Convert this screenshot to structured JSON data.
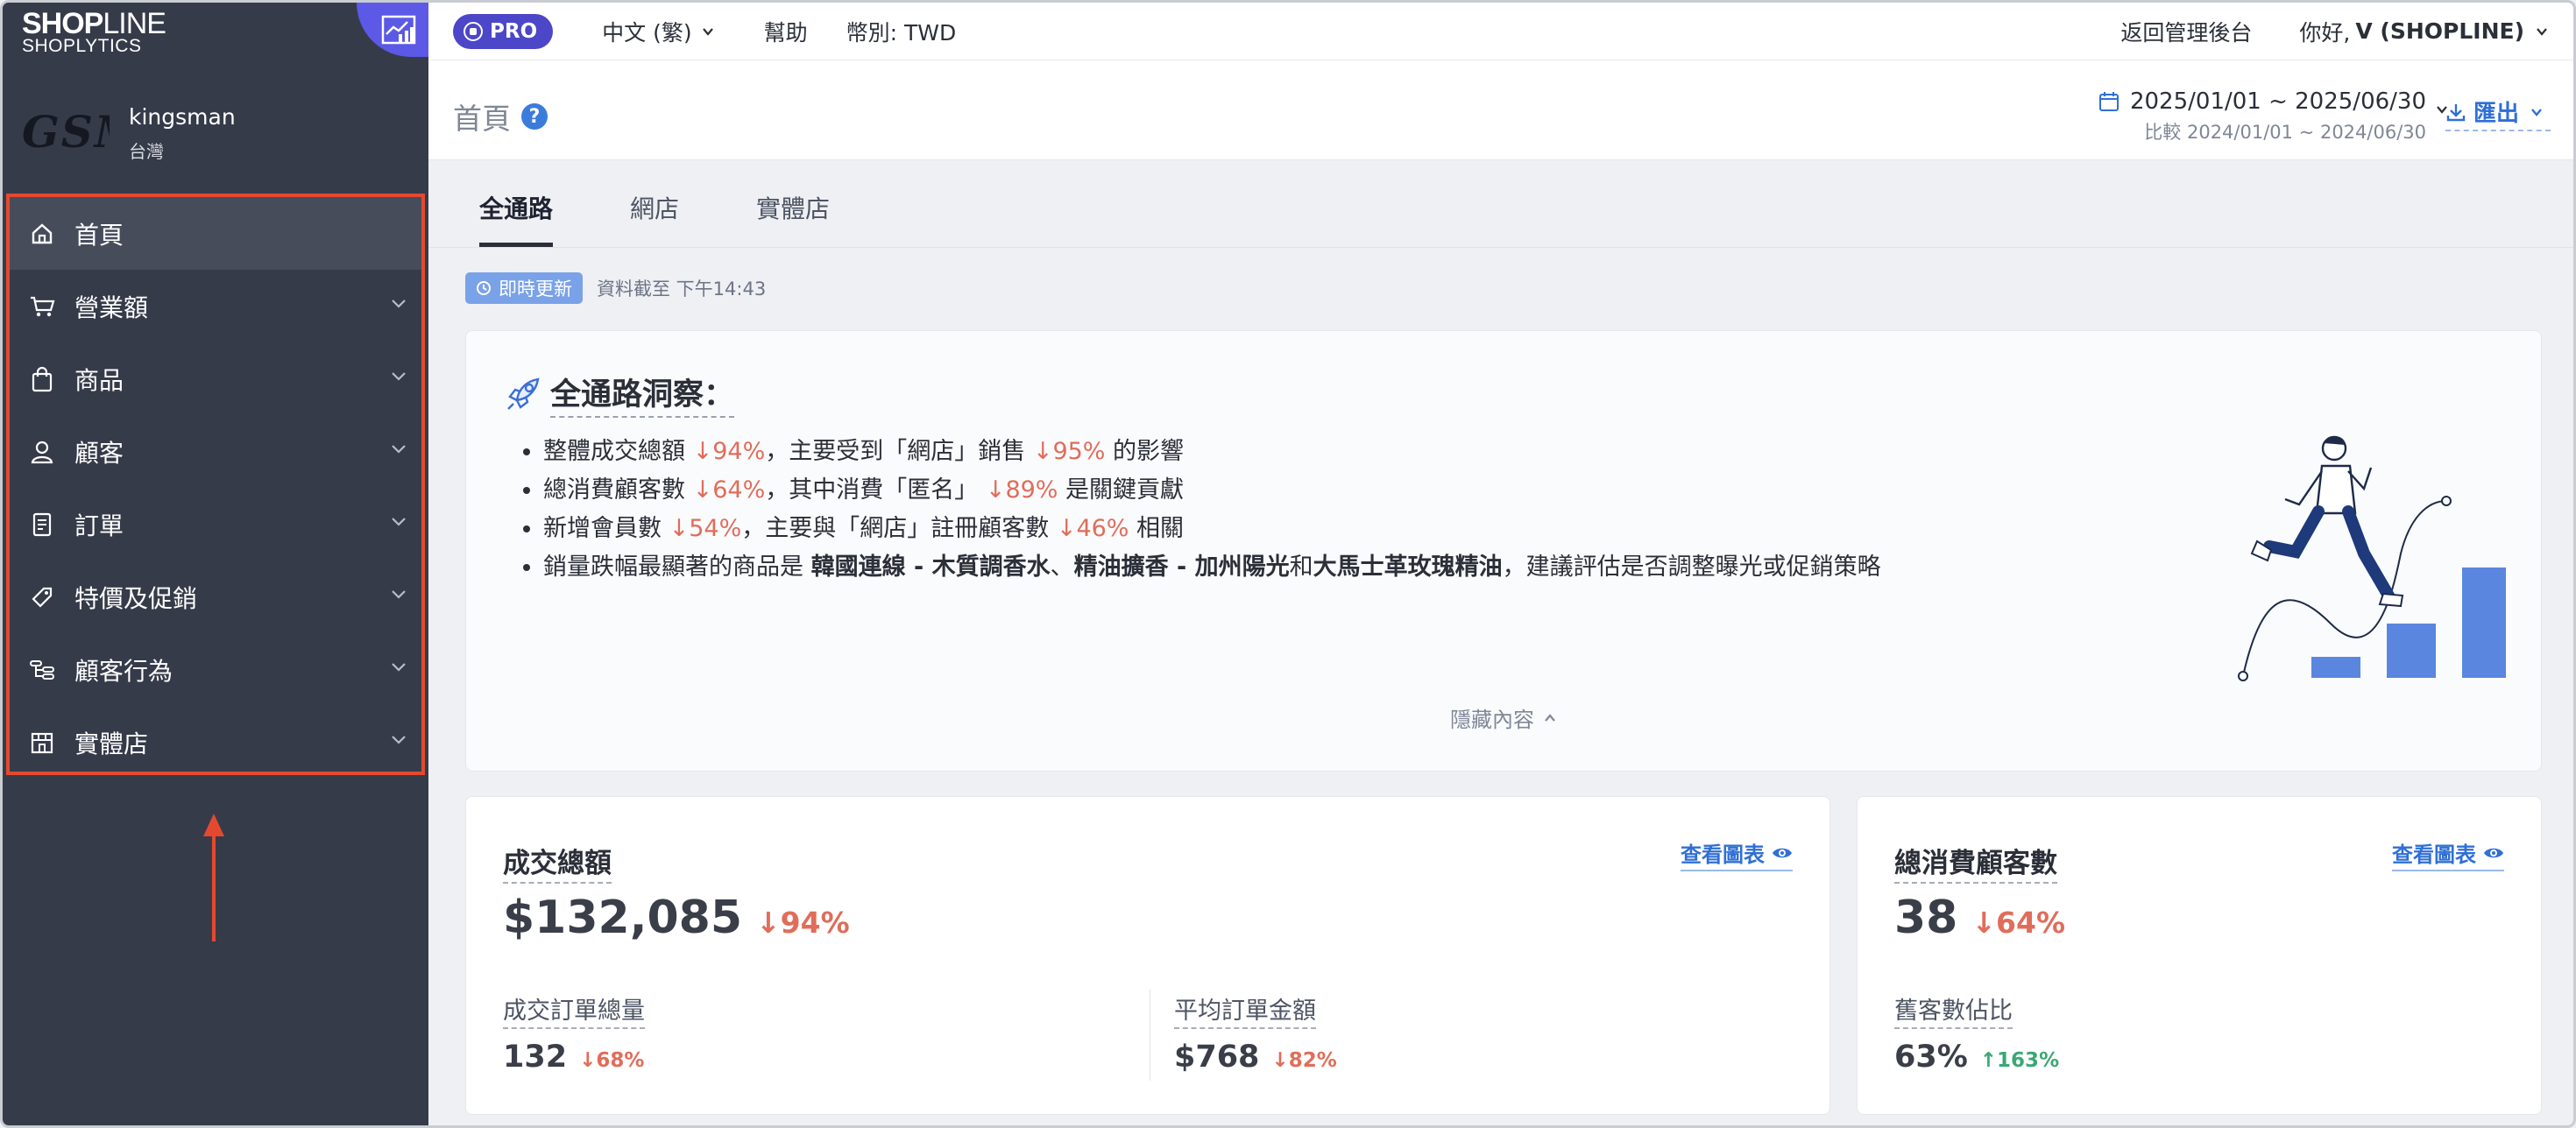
{
  "brand": {
    "logo_bold": "SHOP",
    "logo_thin": "LINE",
    "sub": "SHOPLYTICS"
  },
  "shop": {
    "logo_text": "GSM",
    "name": "kingsman",
    "region": "台灣"
  },
  "sidebar": {
    "items": [
      {
        "label": "首頁",
        "icon": "home-icon"
      },
      {
        "label": "營業額",
        "icon": "cart-icon"
      },
      {
        "label": "商品",
        "icon": "bag-icon"
      },
      {
        "label": "顧客",
        "icon": "user-icon"
      },
      {
        "label": "訂單",
        "icon": "document-icon"
      },
      {
        "label": "特價及促銷",
        "icon": "tag-icon"
      },
      {
        "label": "顧客行為",
        "icon": "behavior-icon"
      },
      {
        "label": "實體店",
        "icon": "store-icon"
      }
    ]
  },
  "topbar": {
    "pro": "PRO",
    "language": "中文 (繁)",
    "help": "幫助",
    "currency": "幣別: TWD",
    "back_admin": "返回管理後台",
    "greet": "你好,",
    "user": "V (SHOPLINE)"
  },
  "page": {
    "title": "首頁",
    "help_glyph": "?",
    "date_range": "2025/01/01 ~ 2025/06/30",
    "compare": "比較 2024/01/01 ~ 2024/06/30",
    "export": "匯出"
  },
  "tabs": [
    "全通路",
    "網店",
    "實體店"
  ],
  "live": {
    "badge": "即時更新",
    "timestamp": "資料截至 下午14:43"
  },
  "insight": {
    "title": "全通路洞察：",
    "lines": {
      "l1": {
        "a": "整體成交總額 ",
        "d1": "↓94%",
        "b": "，主要受到「網店」銷售 ",
        "d2": "↓95%",
        "c": " 的影響"
      },
      "l2": {
        "a": "總消費顧客數 ",
        "d1": "↓64%",
        "b": "，其中消費「匿名」 ",
        "d2": "↓89%",
        "c": " 是關鍵貢獻"
      },
      "l3": {
        "a": "新增會員數 ",
        "d1": "↓54%",
        "b": "，主要與「網店」註冊顧客數 ",
        "d2": "↓46%",
        "c": " 相關"
      },
      "l4": {
        "a": "銷量跌幅最顯著的商品是 ",
        "p1": "韓國連線 - 木質調香水",
        "s1": "、",
        "p2": "精油擴香 - 加州陽光",
        "s2": "和",
        "p3": "大馬士革玫瑰精油",
        "c": "，建議評估是否調整曝光或促銷策略"
      }
    },
    "collapse": "隱藏內容"
  },
  "cards": {
    "gmv": {
      "title": "成交總額",
      "view": "查看圖表",
      "value": "$132,085",
      "delta": "↓94%",
      "sub1": {
        "label": "成交訂單總量",
        "value": "132",
        "delta": "↓68%"
      },
      "sub2": {
        "label": "平均訂單金額",
        "value": "$768",
        "delta": "↓82%"
      }
    },
    "customers": {
      "title": "總消費顧客數",
      "view": "查看圖表",
      "value": "38",
      "delta": "↓64%",
      "sub1": {
        "label": "舊客數佔比",
        "value": "63%",
        "delta": "↑163%"
      }
    }
  },
  "colors": {
    "sidebar_bg": "#363b4a",
    "accent": "#4c46c9",
    "link": "#2f6fd6",
    "negative": "#e06d5a",
    "positive": "#3aa875",
    "highlight_border": "#e4492f"
  }
}
